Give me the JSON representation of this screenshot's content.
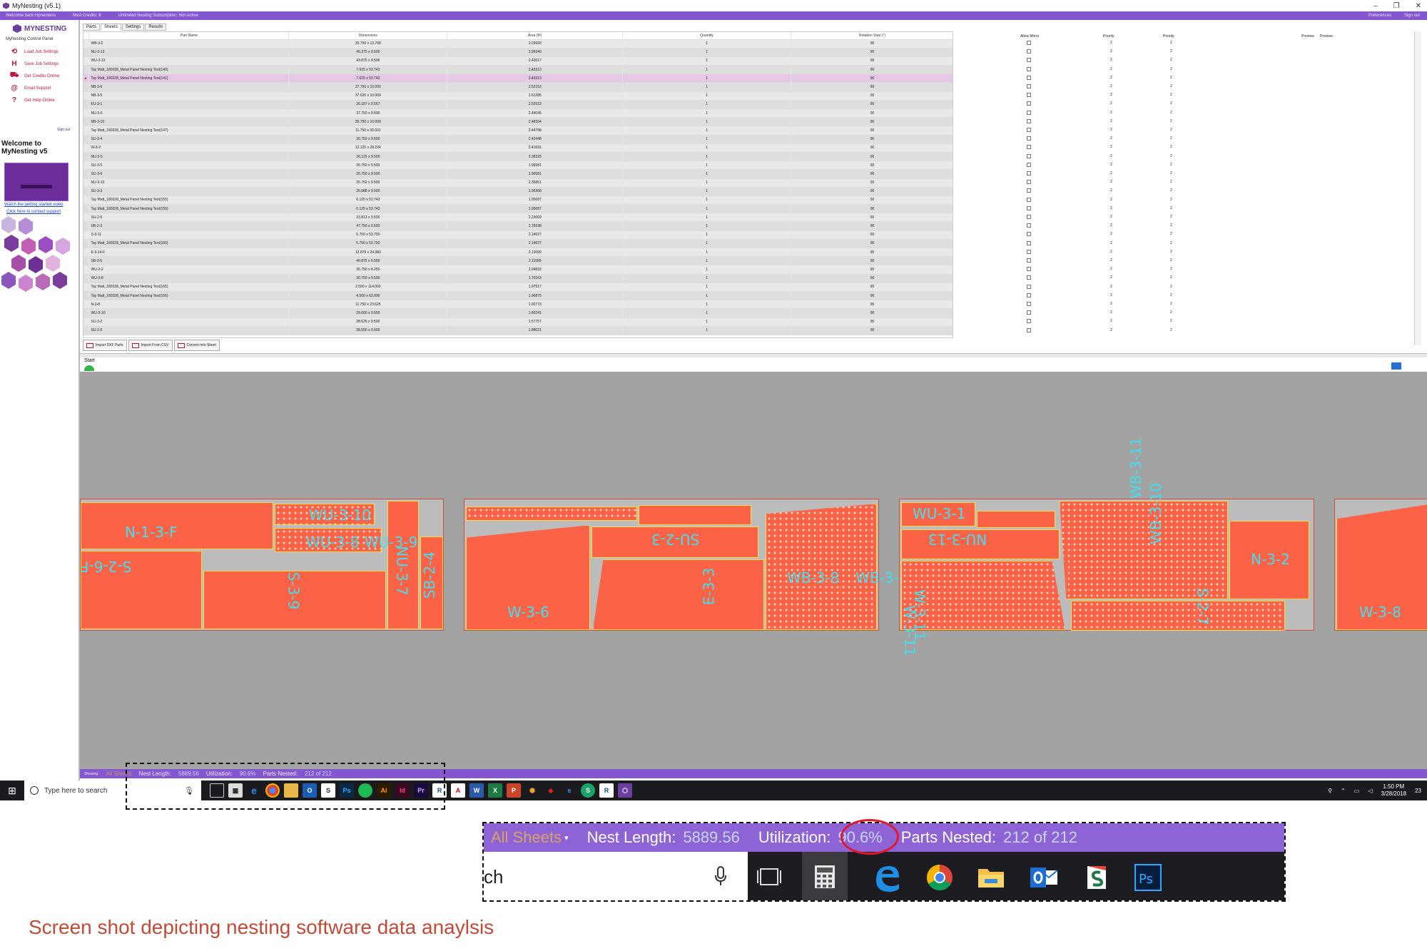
{
  "window": {
    "title": "MyNesting (v5.1)",
    "welcome": "Welcome back Hpnesterio",
    "nest_credits": "Nest Credits: 8",
    "subscription": "Unlimited Nesting Subscription: Not Active",
    "preferences": "Preferences",
    "sign_out": "Sign out"
  },
  "sidebar": {
    "brand": "MYNESTING",
    "control_panel": "MyNesting Control Panel",
    "items": [
      {
        "label": "Load Job Settings",
        "icon": "load-icon"
      },
      {
        "label": "Save Job Settings",
        "icon": "save-icon"
      },
      {
        "label": "Get Credits Online",
        "icon": "credits-icon"
      },
      {
        "label": "Email Support",
        "icon": "email-icon"
      },
      {
        "label": "Get Help Online",
        "icon": "help-icon"
      }
    ],
    "sign_out": "Sign out",
    "welcome_title": "Welcome to MyNesting v5",
    "video_link": "Watch the getting started video",
    "support_link": "Click here to contact support"
  },
  "tabs": [
    "Parts",
    "Sheets",
    "Settings",
    "Results"
  ],
  "table": {
    "columns": [
      "Part Name",
      "Dimensions",
      "Area (ft²)",
      "Quantity",
      "Rotation Step (°)"
    ],
    "rows": [
      [
        "WB-3-2",
        "35.750 x 13.768",
        "3.03693",
        "1",
        "90"
      ],
      [
        "NU-3-13",
        "45.375 x 9.500",
        "2.99349",
        "1",
        "90"
      ],
      [
        "WU-3-12",
        "43.875 x 9.506",
        "2.43017",
        "1",
        "90"
      ],
      [
        "Tay Matt_180328_Metal Panel Nesting Test(140)",
        "7.625 x 53.743",
        "2.43313",
        "1",
        "90"
      ],
      [
        "Tay Matt_180328_Metal Panel Nesting Test(141)",
        "7.625 x 53.743",
        "2.43313",
        "1",
        "90"
      ],
      [
        "NB-3-6",
        "37.750 x 10.000",
        "2.62153",
        "1",
        "90"
      ],
      [
        "NB-3-5",
        "37.625 x 10.000",
        "2.61285",
        "1",
        "90"
      ],
      [
        "EU-2-1",
        "36.187 x 9.567",
        "2.52523",
        "1",
        "90"
      ],
      [
        "NU-3-6",
        "37.750 x 9.500",
        "2.49045",
        "1",
        "90"
      ],
      [
        "NB-3-10",
        "35.750 x 10.000",
        "2.48264",
        "1",
        "90"
      ],
      [
        "Tay Matt_180328_Metal Panel Nesting Test(147)",
        "11.750 x 30.001",
        "2.44798",
        "1",
        "90"
      ],
      [
        "SU-2-4",
        "36.750 x 9.500",
        "2.42448",
        "1",
        "90"
      ],
      [
        "W-3-2",
        "12.125 x 29.224",
        "2.41691",
        "1",
        "90"
      ],
      [
        "NU-3-5",
        "36.125 x 9.500",
        "2.38325",
        "1",
        "90"
      ],
      [
        "SU-3-5",
        "35.750 x 9.500",
        "1.96581",
        "1",
        "90"
      ],
      [
        "SU-3-6",
        "35.750 x 9.500",
        "1.96581",
        "1",
        "90"
      ],
      [
        "NU-3-10",
        "35.750 x 9.500",
        "2.35851",
        "1",
        "90"
      ],
      [
        "SU-3-3",
        "35.688 x 9.500",
        "1.96368",
        "1",
        "90"
      ],
      [
        "Tay Matt_180328_Metal Panel Nesting Test(155)",
        "6.125 x 53.743",
        "1.95687",
        "1",
        "90"
      ],
      [
        "Tay Matt_180328_Metal Panel Nesting Test(156)",
        "6.125 x 53.743",
        "1.95687",
        "1",
        "90"
      ],
      [
        "SU-2-5",
        "33.813 x 9.500",
        "2.23069",
        "1",
        "90"
      ],
      [
        "SB-2-3",
        "47.750 x 6.500",
        "2.15538",
        "1",
        "90"
      ],
      [
        "S-3-11",
        "5.750 x 53.750",
        "2.14627",
        "1",
        "90"
      ],
      [
        "Tay Matt_180328_Metal Panel Nesting Test(160)",
        "5.750 x 53.750",
        "2.14627",
        "1",
        "90"
      ],
      [
        "E-3-14-F",
        "12.879 x 24.383",
        "2.13099",
        "1",
        "90"
      ],
      [
        "SB-2-6",
        "46.875 x 6.500",
        "2.11589",
        "1",
        "90"
      ],
      [
        "WU-2-2",
        "35.750 x 8.250",
        "2.04818",
        "1",
        "90"
      ],
      [
        "WU-3-8",
        "30.750 x 9.500",
        "1.70163",
        "1",
        "90"
      ],
      [
        "Tay Matt_180328_Metal Panel Nesting Test(165)",
        "2.500 x 114.000",
        "1.97917",
        "1",
        "90"
      ],
      [
        "Tay Matt_180328_Metal Panel Nesting Test(166)",
        "4.500 x 63.000",
        "1.96875",
        "1",
        "90"
      ],
      [
        "N-3-8",
        "11.750 x 23.625",
        "1.92773",
        "1",
        "90"
      ],
      [
        "WU-3-10",
        "29.000 x 9.500",
        "1.60241",
        "1",
        "90"
      ],
      [
        "SU-3-2",
        "28.625 x 9.500",
        "1.57757",
        "1",
        "90"
      ],
      [
        "SU-2-6",
        "28.500 x 9.500",
        "1.88021",
        "1",
        "90"
      ]
    ],
    "selected_index": 4,
    "right_columns": [
      "Allow Mirror",
      "Priority",
      "Priority",
      "Preview",
      "Preview"
    ],
    "priority_value": "2"
  },
  "buttons": {
    "import_dxf": "Import DXF Parts",
    "import_csv": "Import From CSV",
    "convert_sheet": "Convert into Sheet",
    "start": "Start"
  },
  "parts": {
    "n13f": "N-1-3-F",
    "wu310": "WU-3-10",
    "wu38": "WU-3-8",
    "wu39": "WU-3-9",
    "s26f": "S-2-6-F",
    "s39": "S-3-9",
    "nu37": "NU-3-7",
    "sb24": "SB-2-4",
    "su23": "SU-2-3",
    "w36": "W-3-6",
    "e33": "E-3-3",
    "wb38": "WB-3-8",
    "wb39": "WB-3-9",
    "wu31": "WU-3-1",
    "nu313": "NU-3-13",
    "wb311": "WB-3-11",
    "wb310": "WB-3-10",
    "n32": "N-3-2",
    "s27": "S-2-7",
    "w311": "W-3-11",
    "ww311": "W-3-11",
    "w38": "W-3-8"
  },
  "status": {
    "showing": "Showing:",
    "sheets": "All Sheets",
    "nest_length_label": "Nest Length:",
    "nest_length": "5889.56",
    "utilization_label": "Utilization:",
    "utilization": "90.6%",
    "parts_nested_label": "Parts Nested:",
    "parts_nested": "212 of 212"
  },
  "taskbar": {
    "search_placeholder": "Type here to search",
    "time": "1:50 PM",
    "date": "3/28/2018",
    "notifications": "23"
  },
  "zoom": {
    "search_fragment": "ch"
  },
  "caption": "Screen shot depicting nesting software data anaylsis",
  "colors": {
    "accent": "#8456cf",
    "part_fill": "#fb6246",
    "part_label": "#3fe0f0",
    "highlight_circle": "#e0182a"
  }
}
